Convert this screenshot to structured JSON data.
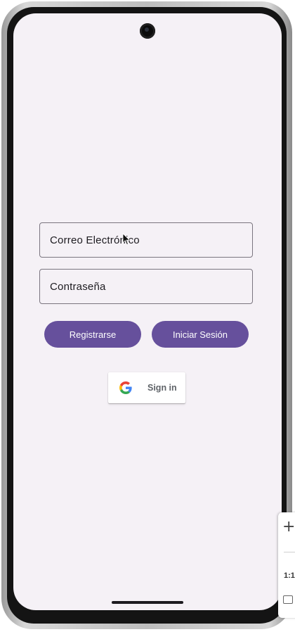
{
  "form": {
    "email_placeholder": "Correo Electrónico",
    "password_placeholder": "Contraseña"
  },
  "buttons": {
    "register_label": "Registrarse",
    "login_label": "Iniciar Sesión"
  },
  "google": {
    "label": "Sign in",
    "icon": "google-g-icon"
  },
  "emulator_toolbar": {
    "zoom_in_icon": "plus-icon",
    "ratio_label": "1:1",
    "fit_icon": "fit-screen-icon"
  },
  "colors": {
    "primary": "#66509c",
    "screen_background": "#f5f1f6",
    "outline": "#7a757f"
  }
}
